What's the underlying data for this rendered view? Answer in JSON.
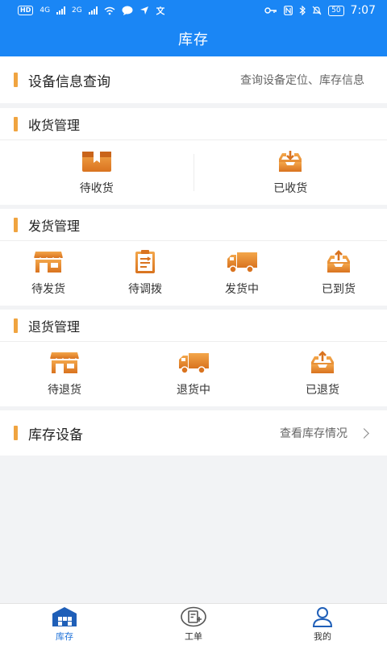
{
  "status_bar": {
    "left_badges": [
      "HD",
      "4G",
      "2G"
    ],
    "time": "7:07",
    "battery": "50"
  },
  "header": {
    "title": "库存"
  },
  "device_query": {
    "title": "设备信息查询",
    "hint": "查询设备定位、库存信息"
  },
  "receive": {
    "title": "收货管理",
    "items": [
      {
        "label": "待收货",
        "icon": "box-icon"
      },
      {
        "label": "已收货",
        "icon": "inbox-download-icon"
      }
    ]
  },
  "ship": {
    "title": "发货管理",
    "items": [
      {
        "label": "待发货",
        "icon": "shop-icon"
      },
      {
        "label": "待调拨",
        "icon": "clipboard-icon"
      },
      {
        "label": "发货中",
        "icon": "truck-icon"
      },
      {
        "label": "已到货",
        "icon": "inbox-upload-icon"
      }
    ]
  },
  "returns": {
    "title": "退货管理",
    "items": [
      {
        "label": "待退货",
        "icon": "shop-icon"
      },
      {
        "label": "退货中",
        "icon": "truck-icon"
      },
      {
        "label": "已退货",
        "icon": "inbox-upload-icon"
      }
    ]
  },
  "stock_devices": {
    "title": "库存设备",
    "link": "查看库存情况"
  },
  "tab_bar": {
    "tabs": [
      {
        "label": "库存",
        "icon": "warehouse-icon",
        "active": true
      },
      {
        "label": "工单",
        "icon": "work-order-icon",
        "active": false
      },
      {
        "label": "我的",
        "icon": "user-icon",
        "active": false
      }
    ]
  },
  "colors": {
    "primary": "#1a86f5",
    "accent": "#f0a440",
    "icon_orange": "#e8822a",
    "background": "#f2f3f5"
  }
}
